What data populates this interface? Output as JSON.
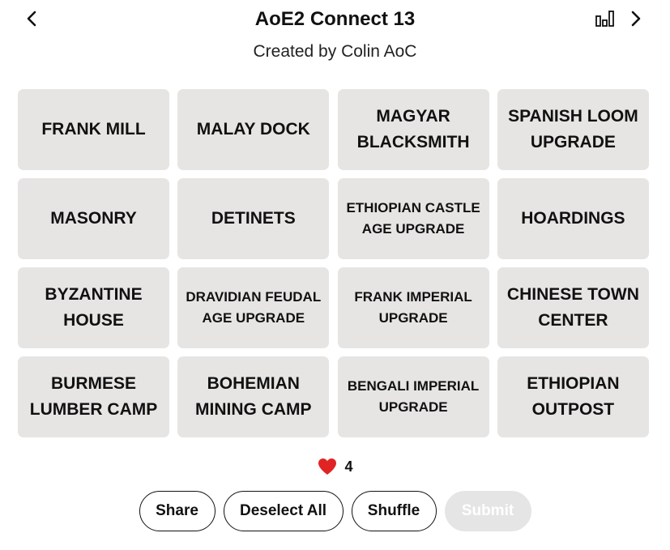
{
  "header": {
    "title": "AoE2 Connect 13",
    "subtitle": "Created by Colin AoC",
    "prev_icon": "chevron-left-icon",
    "next_icon": "chevron-right-icon",
    "stats_icon": "bar-chart-icon"
  },
  "tiles": [
    {
      "label": "FRANK MILL",
      "size": "big"
    },
    {
      "label": "MALAY DOCK",
      "size": "big"
    },
    {
      "label": "MAGYAR BLACKSMITH",
      "size": "big"
    },
    {
      "label": "SPANISH LOOM UPGRADE",
      "size": "big"
    },
    {
      "label": "MASONRY",
      "size": "big"
    },
    {
      "label": "DETINETS",
      "size": "big"
    },
    {
      "label": "ETHIOPIAN CASTLE AGE UPGRADE",
      "size": "small"
    },
    {
      "label": "HOARDINGS",
      "size": "big"
    },
    {
      "label": "BYZANTINE HOUSE",
      "size": "big"
    },
    {
      "label": "DRAVIDIAN FEUDAL AGE UPGRADE",
      "size": "small"
    },
    {
      "label": "FRANK IMPERIAL UPGRADE",
      "size": "small"
    },
    {
      "label": "CHINESE TOWN CENTER",
      "size": "big"
    },
    {
      "label": "BURMESE LUMBER CAMP",
      "size": "big"
    },
    {
      "label": "BOHEMIAN MINING CAMP",
      "size": "big"
    },
    {
      "label": "BENGALI IMPERIAL UPGRADE",
      "size": "small"
    },
    {
      "label": "ETHIOPIAN OUTPOST",
      "size": "big"
    }
  ],
  "lives": {
    "icon": "heart-icon",
    "count": "4",
    "color": "#e02424"
  },
  "actions": {
    "share_label": "Share",
    "deselect_label": "Deselect All",
    "shuffle_label": "Shuffle",
    "submit_label": "Submit"
  },
  "colors": {
    "tile_bg": "#e7e5e4",
    "submit_disabled_bg": "#e5e5e5"
  }
}
